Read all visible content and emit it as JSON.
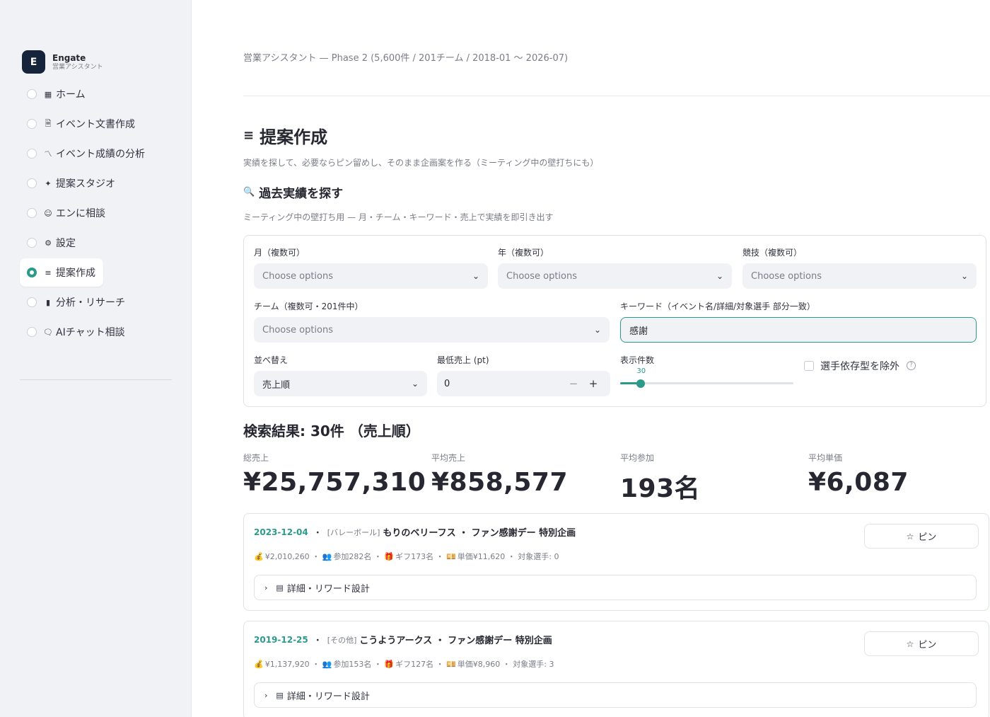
{
  "sidebar": {
    "brand": {
      "logo_letter": "E",
      "name": "Engate",
      "subtitle": "営業アシスタント"
    },
    "items": [
      {
        "icon": "grid-icon",
        "glyph": "▦",
        "label": "ホーム",
        "active": false
      },
      {
        "icon": "document-icon",
        "glyph": "🗎",
        "label": "イベント文書作成",
        "active": false
      },
      {
        "icon": "trend-icon",
        "glyph": "〽",
        "label": "イベント成績の分析",
        "active": false
      },
      {
        "icon": "sparkle-icon",
        "glyph": "✦",
        "label": "提案スタジオ",
        "active": false
      },
      {
        "icon": "support-icon",
        "glyph": "☺",
        "label": "エンに相談",
        "active": false
      },
      {
        "icon": "gear-icon",
        "glyph": "⚙",
        "label": "設定",
        "active": false
      },
      {
        "icon": "edit-list-icon",
        "glyph": "≡",
        "label": "提案作成",
        "active": true
      },
      {
        "icon": "bar-chart-icon",
        "glyph": "▮",
        "label": "分析・リサーチ",
        "active": false
      },
      {
        "icon": "chat-icon",
        "glyph": "🗨",
        "label": "AIチャット相談",
        "active": false
      }
    ]
  },
  "header": {
    "breadcrumb": "営業アシスタント — Phase 2 (5,600件 / 201チーム / 2018-01 〜 2026-07)"
  },
  "page": {
    "title": "提案作成",
    "description": "実績を探して、必要ならピン留めし、そのまま企画案を作る（ミーティング中の壁打ちにも）",
    "section_title": "過去実績を探す",
    "section_description": "ミーティング中の壁打ち用 — 月・チーム・キーワード・売上で実績を即引き出す"
  },
  "filters": {
    "month": {
      "label": "月（複数可）",
      "placeholder": "Choose options"
    },
    "year": {
      "label": "年（複数可）",
      "placeholder": "Choose options"
    },
    "sport": {
      "label": "競技（複数可）",
      "placeholder": "Choose options"
    },
    "team": {
      "label": "チーム（複数可・201件中）",
      "placeholder": "Choose options"
    },
    "keyword": {
      "label": "キーワード（イベント名/詳細/対象選手 部分一致）",
      "value": "感謝"
    },
    "sort": {
      "label": "並べ替え",
      "value": "売上順"
    },
    "min_sales": {
      "label": "最低売上 (pt)",
      "value": "0",
      "minus": "−",
      "plus": "+"
    },
    "count": {
      "label": "表示件数",
      "value": "30",
      "level_fraction": 0.12
    },
    "exclude": {
      "label": "選手依存型を除外",
      "help": "?",
      "checked": false
    }
  },
  "results": {
    "title": "検索結果: 30件 （売上順）",
    "metrics": [
      {
        "label": "総売上",
        "value": "¥25,757,310"
      },
      {
        "label": "平均売上",
        "value": "¥858,577"
      },
      {
        "label": "平均参加",
        "value": "193名"
      },
      {
        "label": "平均単価",
        "value": "¥6,087"
      }
    ],
    "cards": [
      {
        "date": "2023-12-04",
        "genre": "[バレーボール]",
        "title": "もりのベリーフス ・ ファン感謝デー 特別企画",
        "sales": "¥2,010,260",
        "participants": "参加282名",
        "gifts": "ギフ173名",
        "unit_price": "単価¥11,620",
        "target": "対象選手: 0",
        "pin_label": "ピン",
        "expander_label": "詳細・リワード設計"
      },
      {
        "date": "2019-12-25",
        "genre": "[その他]",
        "title": "こうようアークス ・ ファン感謝デー 特別企画",
        "sales": "¥1,137,920",
        "participants": "参加153名",
        "gifts": "ギフ127名",
        "unit_price": "単価¥8,960",
        "target": "対象選手: 3",
        "pin_label": "ピン",
        "expander_label": "詳細・リワード設計"
      }
    ]
  },
  "colors": {
    "accent": "#2b9a8a",
    "brand_dark": "#15233b",
    "sidebar_bg": "#f0f2f6"
  }
}
